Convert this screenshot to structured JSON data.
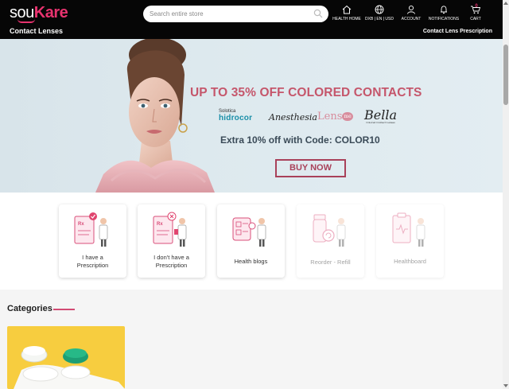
{
  "brand": {
    "logo_part1": "sou",
    "logo_part2": "Kare",
    "accent_color": "#e8336f"
  },
  "search": {
    "placeholder": "Search entire store",
    "icon": "search-icon"
  },
  "header": {
    "subtitle_left": "Contact Lenses",
    "subtitle_right": "Contact Lens Prescription",
    "nav": [
      {
        "label": "HEALTH HOME",
        "icon": "home-icon"
      },
      {
        "label": "DXB | EN | USD",
        "icon": "globe-icon"
      },
      {
        "label": "ACCOUNT",
        "icon": "user-icon"
      },
      {
        "label": "NOTIFICATIONS",
        "icon": "bell-icon"
      },
      {
        "label": "CART",
        "icon": "cart-icon",
        "count": "0"
      }
    ]
  },
  "banner": {
    "title": "UP TO 35% OFF COLORED CONTACTS",
    "brands": {
      "solotica_small": "Solotica",
      "solotica_main": "hidrocor",
      "anesthesia": "Anesthesia",
      "lens": "Lens",
      "lens_badge": "me",
      "bella": "Bella",
      "bella_small": "Colored Contact Lenses"
    },
    "code_text": "Extra 10% off with Code: COLOR10",
    "button_label": "BUY NOW",
    "title_color": "#c5566b"
  },
  "quick_links": [
    {
      "label_line1": "I have a",
      "label_line2": "Prescription",
      "icon": "prescription-check-icon",
      "enabled": true
    },
    {
      "label_line1": "I don't have a",
      "label_line2": "Prescription",
      "icon": "prescription-cross-icon",
      "enabled": true
    },
    {
      "label_line1": "Health blogs",
      "label_line2": "",
      "icon": "health-blogs-icon",
      "enabled": true
    },
    {
      "label_line1": "Reorder - Refill",
      "label_line2": "",
      "icon": "reorder-refill-icon",
      "enabled": false
    },
    {
      "label_line1": "Healthboard",
      "label_line2": "",
      "icon": "healthboard-icon",
      "enabled": false
    }
  ],
  "categories": {
    "title": "Categories"
  }
}
